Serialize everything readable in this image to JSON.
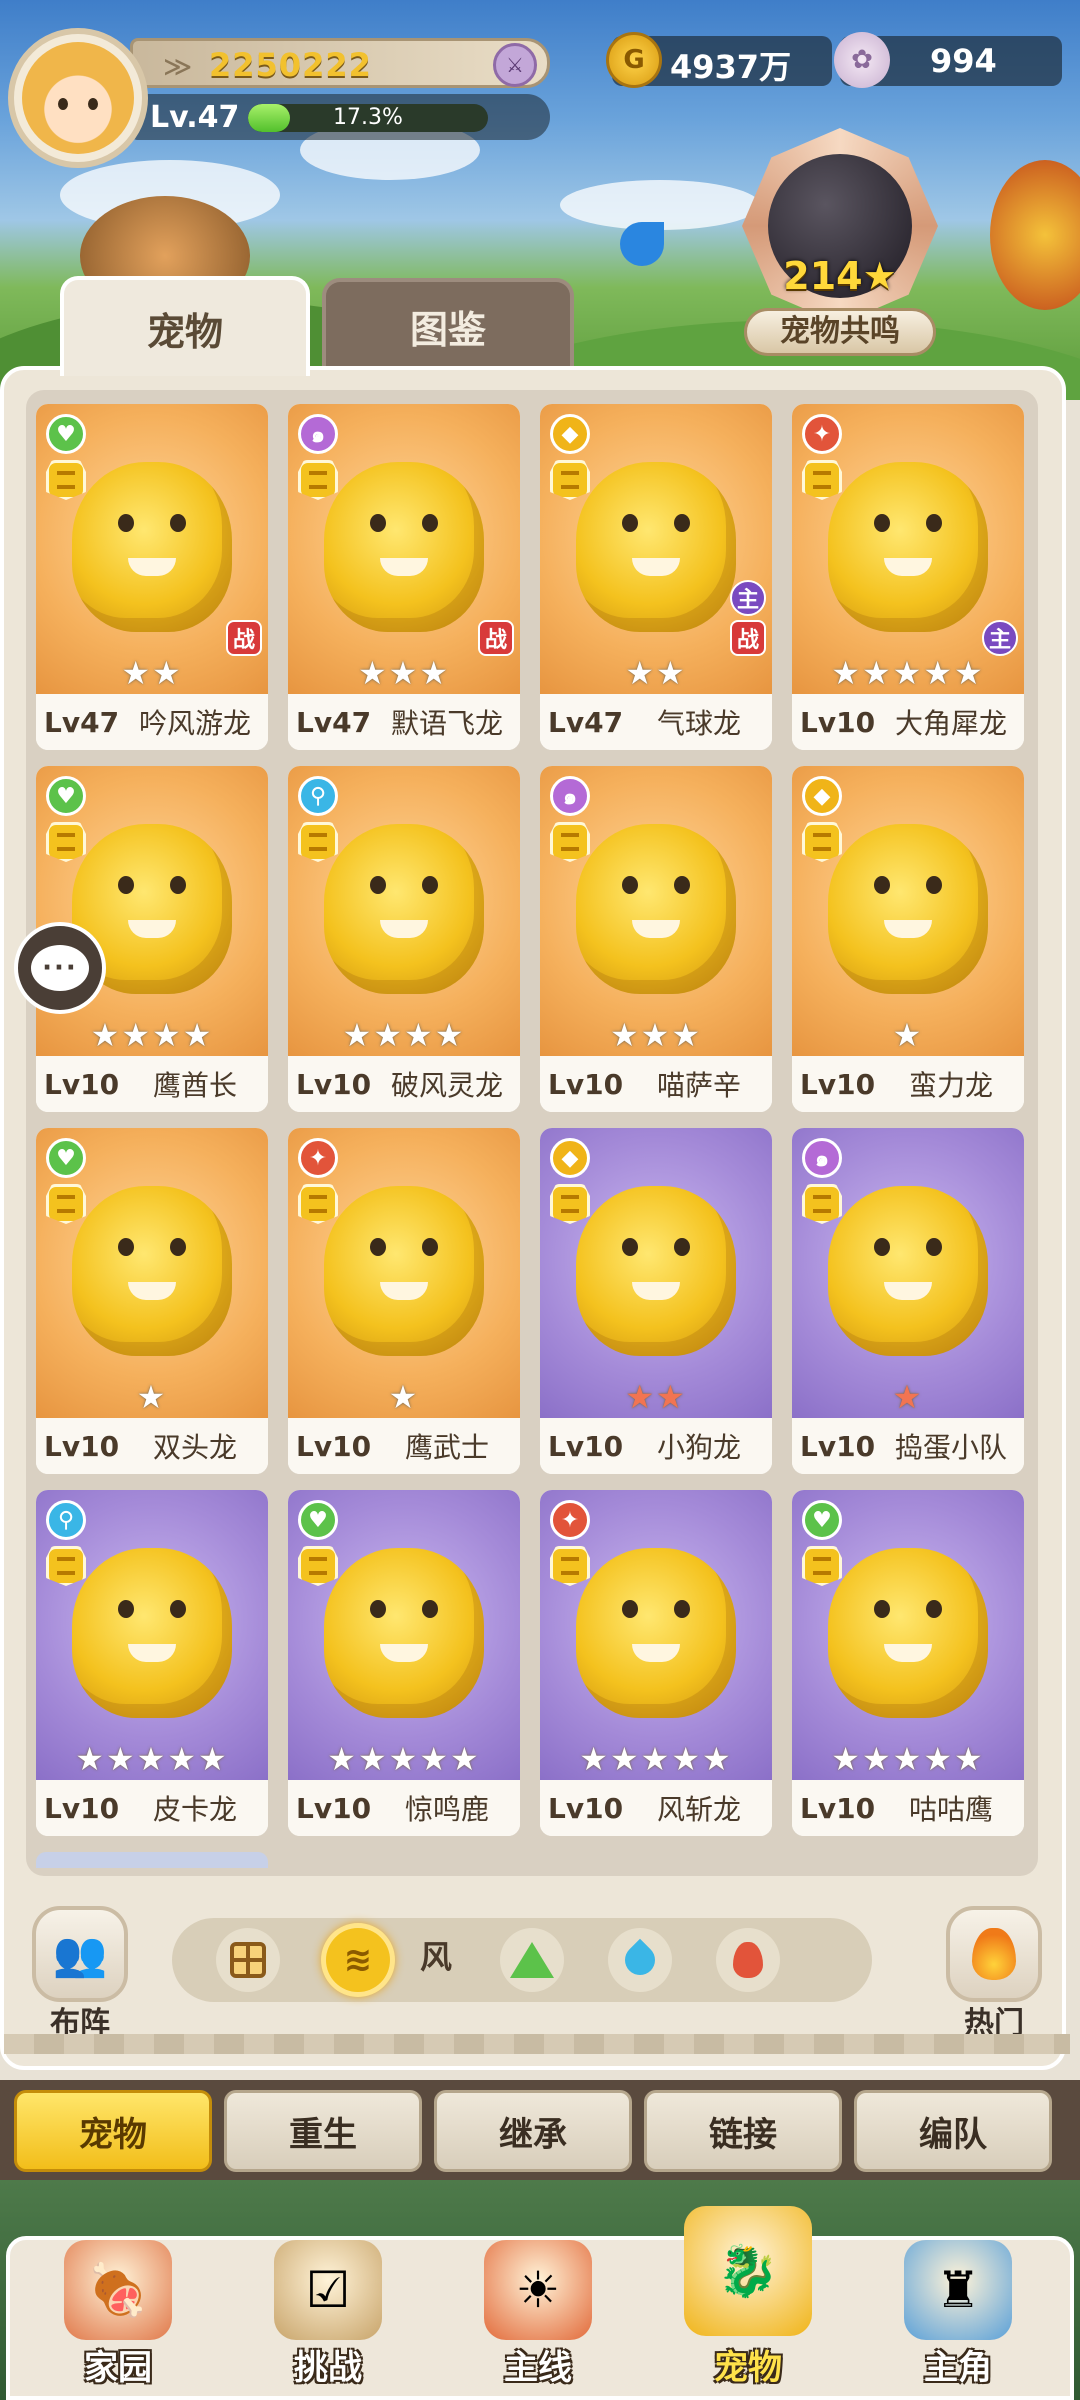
{
  "player": {
    "power": "2250222",
    "level_label": "Lv.47",
    "xp_percent_label": "17.3%",
    "xp_fraction": 0.173,
    "rank_icon": "crossed-swords-icon"
  },
  "currencies": {
    "gold": {
      "icon": "gold-coin-icon",
      "amount": "4937万"
    },
    "shell": {
      "icon": "shell-icon",
      "amount": "994"
    }
  },
  "resonance": {
    "value": "214★",
    "label": "宠物共鸣"
  },
  "tabs": {
    "pets": "宠物",
    "codex": "图鉴"
  },
  "chat": {
    "icon": "chat-bubble-icon",
    "glyph": "···"
  },
  "pets": [
    {
      "level": "Lv47",
      "name": "吟风游龙",
      "element": "green",
      "stars": "★★",
      "star_color": "white",
      "bg": "orange",
      "battle": true,
      "main": false
    },
    {
      "level": "Lv47",
      "name": "默语飞龙",
      "element": "purple",
      "stars": "★★★",
      "star_color": "white",
      "bg": "orange",
      "battle": true,
      "main": false
    },
    {
      "level": "Lv47",
      "name": "气球龙",
      "element": "yellow",
      "stars": "★★",
      "star_color": "white",
      "bg": "orange",
      "battle": true,
      "main": true
    },
    {
      "level": "Lv10",
      "name": "大角犀龙",
      "element": "red",
      "stars": "★★★★★",
      "star_color": "white",
      "bg": "orange",
      "battle": false,
      "main": true
    },
    {
      "level": "Lv10",
      "name": "鹰酋长",
      "element": "green",
      "stars": "★★★★",
      "star_color": "white",
      "bg": "orange",
      "battle": false,
      "main": false
    },
    {
      "level": "Lv10",
      "name": "破风灵龙",
      "element": "blue",
      "stars": "★★★★",
      "star_color": "white",
      "bg": "orange",
      "battle": false,
      "main": false
    },
    {
      "level": "Lv10",
      "name": "喵萨辛",
      "element": "purple",
      "stars": "★★★",
      "star_color": "white",
      "bg": "orange",
      "battle": false,
      "main": false
    },
    {
      "level": "Lv10",
      "name": "蛮力龙",
      "element": "yellow",
      "stars": "★",
      "star_color": "white",
      "bg": "orange",
      "battle": false,
      "main": false
    },
    {
      "level": "Lv10",
      "name": "双头龙",
      "element": "green",
      "stars": "★",
      "star_color": "white",
      "bg": "orange",
      "battle": false,
      "main": false
    },
    {
      "level": "Lv10",
      "name": "鹰武士",
      "element": "red",
      "stars": "★",
      "star_color": "white",
      "bg": "orange",
      "battle": false,
      "main": false
    },
    {
      "level": "Lv10",
      "name": "小狗龙",
      "element": "yellow",
      "stars": "★★",
      "star_color": "red",
      "bg": "purple",
      "battle": false,
      "main": false
    },
    {
      "level": "Lv10",
      "name": "捣蛋小队",
      "element": "purple",
      "stars": "★",
      "star_color": "red",
      "bg": "purple",
      "battle": false,
      "main": false
    },
    {
      "level": "Lv10",
      "name": "皮卡龙",
      "element": "blue",
      "stars": "★★★★★",
      "star_color": "white",
      "bg": "purple",
      "battle": false,
      "main": false
    },
    {
      "level": "Lv10",
      "name": "惊鸣鹿",
      "element": "green",
      "stars": "★★★★★",
      "star_color": "white",
      "bg": "purple",
      "battle": false,
      "main": false
    },
    {
      "level": "Lv10",
      "name": "风斩龙",
      "element": "red",
      "stars": "★★★★★",
      "star_color": "white",
      "bg": "purple",
      "battle": false,
      "main": false
    },
    {
      "level": "Lv10",
      "name": "咕咕鹰",
      "element": "green",
      "stars": "★★★★★",
      "star_color": "white",
      "bg": "purple",
      "battle": false,
      "main": false
    }
  ],
  "badges": {
    "battle": "战",
    "main": "主"
  },
  "element_colors": {
    "green": "#5cc24a",
    "purple": "#b46ad6",
    "yellow": "#f0b418",
    "red": "#e2543a",
    "blue": "#3ab6e6"
  },
  "filters": {
    "left_button": {
      "icon": "team-formation-icon",
      "label": "布阵"
    },
    "right_button": {
      "icon": "fire-icon",
      "label": "热门"
    },
    "options": [
      {
        "icon": "all-grid-icon",
        "active": false
      },
      {
        "icon": "wind-element-icon",
        "active": true
      },
      {
        "icon": "earth-element-icon",
        "active": false
      },
      {
        "icon": "water-element-icon",
        "active": false
      },
      {
        "icon": "fire-element-icon",
        "active": false
      }
    ],
    "active_label": "风"
  },
  "subtabs": [
    {
      "label": "宠物",
      "active": true
    },
    {
      "label": "重生",
      "active": false
    },
    {
      "label": "继承",
      "active": false
    },
    {
      "label": "链接",
      "active": false
    },
    {
      "label": "编队",
      "active": false
    }
  ],
  "nav": [
    {
      "label": "家园",
      "icon": "home-meat-icon",
      "active": false
    },
    {
      "label": "挑战",
      "icon": "challenge-board-icon",
      "active": false
    },
    {
      "label": "主线",
      "icon": "mainline-sun-icon",
      "active": false
    },
    {
      "label": "宠物",
      "icon": "pet-dragon-icon",
      "active": true
    },
    {
      "label": "主角",
      "icon": "hero-tower-icon",
      "active": false
    }
  ]
}
